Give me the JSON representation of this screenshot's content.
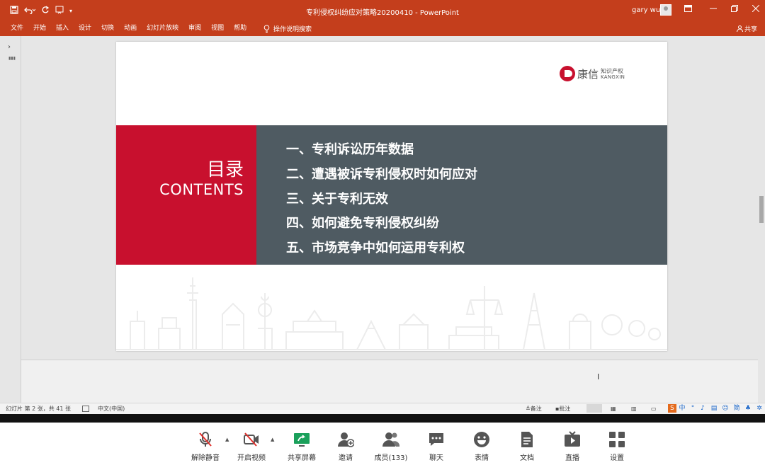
{
  "window": {
    "title": "专利侵权纠纷应对策略20200410 - PowerPoint",
    "user": "gary wu"
  },
  "ribbon": {
    "tabs": [
      "文件",
      "开始",
      "插入",
      "设计",
      "切换",
      "动画",
      "幻灯片放映",
      "审阅",
      "视图",
      "帮助"
    ],
    "tell_me": "操作说明搜索",
    "share": "共享"
  },
  "slide": {
    "logo": {
      "name": "康信",
      "sub_cn": "知识产权",
      "sub_en": "KANGXIN"
    },
    "toc_title_cn": "目录",
    "toc_title_en": "CONTENTS",
    "items": [
      "一、专利诉讼历年数据",
      "二、遭遇被诉专利侵权时如何应对",
      "三、关于专利无效",
      "四、如何避免专利侵权纠纷",
      "五、市场竞争中如何运用专利权"
    ],
    "colors": {
      "red": "#c8102e",
      "gray": "#4f5b62"
    }
  },
  "statusbar": {
    "slide_info": "幻灯片 第 2 张，共 41 张",
    "language": "中文(中国)",
    "notes": "备注",
    "comments": "批注",
    "ime": [
      "中",
      "简"
    ]
  },
  "meeting": {
    "buttons": [
      {
        "label": "解除静音",
        "icon": "muted-mic-icon"
      },
      {
        "label": "开启视频",
        "icon": "video-off-icon"
      },
      {
        "label": "共享屏幕",
        "icon": "share-screen-icon"
      },
      {
        "label": "邀请",
        "icon": "invite-icon"
      },
      {
        "label": "成员(133)",
        "icon": "members-icon"
      },
      {
        "label": "聊天",
        "icon": "chat-icon"
      },
      {
        "label": "表情",
        "icon": "emoji-icon"
      },
      {
        "label": "文档",
        "icon": "document-icon"
      },
      {
        "label": "直播",
        "icon": "live-icon"
      },
      {
        "label": "设置",
        "icon": "settings-icon"
      }
    ]
  }
}
